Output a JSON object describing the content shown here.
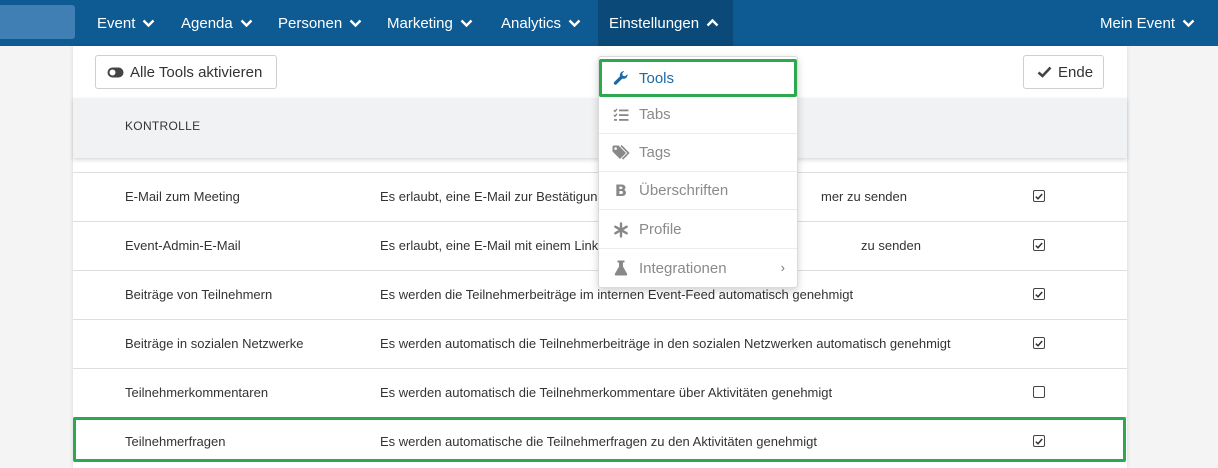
{
  "nav": {
    "items": [
      {
        "label": "Event"
      },
      {
        "label": "Agenda"
      },
      {
        "label": "Personen"
      },
      {
        "label": "Marketing"
      },
      {
        "label": "Analytics"
      },
      {
        "label": "Einstellungen"
      }
    ],
    "right_label": "Mein Event"
  },
  "toolbar": {
    "toggle_all_label": "Alle Tools aktivieren",
    "end_label": "Ende"
  },
  "table": {
    "column_header": "KONTROLLE",
    "rows": [
      {
        "name": "E-Mail zum Meeting",
        "desc_left": "Es erlaubt, eine E-Mail zur Bestätigung",
        "desc_right": "mer zu senden",
        "checked": true
      },
      {
        "name": "Event-Admin-E-Mail",
        "desc_left": "Es erlaubt, eine E-Mail mit einem Link",
        "desc_right": "zu senden",
        "checked": true
      },
      {
        "name": "Beiträge von Teilnehmern",
        "description": "Es werden die Teilnehmerbeiträge im internen Event-Feed automatisch genehmigt",
        "checked": true
      },
      {
        "name": "Beiträge in sozialen Netzwerke",
        "description": "Es werden automatisch die Teilnehmerbeiträge in den sozialen Netzwerken automatisch genehmigt",
        "checked": true
      },
      {
        "name": "Teilnehmerkommentaren",
        "description": "Es werden automatisch die Teilnehmerkommentare über Aktivitäten genehmigt",
        "checked": false
      },
      {
        "name": "Teilnehmerfragen",
        "description": "Es werden automatische die Teilnehmerfragen zu den Aktivitäten genehmigt",
        "checked": true
      }
    ]
  },
  "dropdown": {
    "items": [
      {
        "label": "Tools",
        "icon": "wrench-icon"
      },
      {
        "label": "Tabs",
        "icon": "list-check-icon"
      },
      {
        "label": "Tags",
        "icon": "tags-icon"
      },
      {
        "label": "Überschriften",
        "icon": "bold-icon"
      },
      {
        "label": "Profile",
        "icon": "asterisk-icon"
      },
      {
        "label": "Integrationen",
        "icon": "flask-icon",
        "submenu_arrow": "›"
      }
    ]
  },
  "colors": {
    "nav_bg": "#0e5a93",
    "highlight": "#2ea84f",
    "selected_text": "#1a6aa5"
  }
}
